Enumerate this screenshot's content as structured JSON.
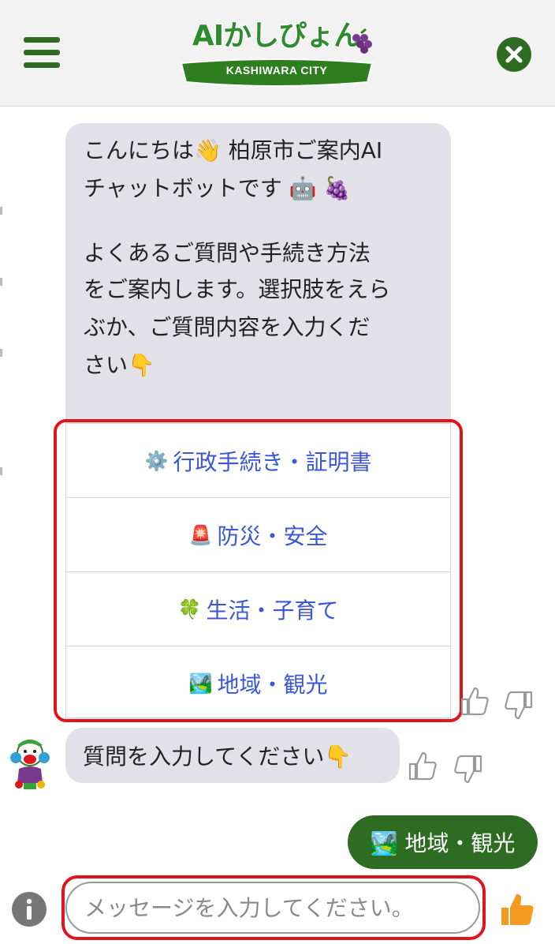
{
  "header": {
    "logo_title": "AIかしぴょん",
    "logo_subtitle": "KASHIWARA CITY",
    "menu_icon": "hamburger-menu-icon",
    "close_icon": "close-circle-icon"
  },
  "bot_message": {
    "line1": "こんにちは👋 柏原市ご案内AI",
    "line2": "チャットボットです 🤖 🍇",
    "para2_line1": "よくあるご質問や手続き方法",
    "para2_line2": "をご案内します。選択肢をえら",
    "para2_line3": "ぶか、ご質問内容を入力くだ",
    "para2_line4": "さい👇"
  },
  "options": [
    {
      "emoji": "⚙️",
      "label": "行政手続き・証明書"
    },
    {
      "emoji": "🚨",
      "label": "防災・安全"
    },
    {
      "emoji": "🍀",
      "label": "生活・子育て"
    },
    {
      "emoji": "🏞️",
      "label": "地域・観光"
    }
  ],
  "bot_message2": {
    "text": "質問を入力してください👇"
  },
  "user_message": {
    "text": "🏞️ 地域・観光"
  },
  "composer": {
    "placeholder": "メッセージを入力してください。",
    "info_icon": "info-icon",
    "send_icon": "thumbs-up-send-icon"
  },
  "colors": {
    "brand_green": "#2e6b23",
    "bubble_gray": "#e3e1e8",
    "option_blue": "#3b57d6",
    "highlight_red": "#e0151c"
  }
}
